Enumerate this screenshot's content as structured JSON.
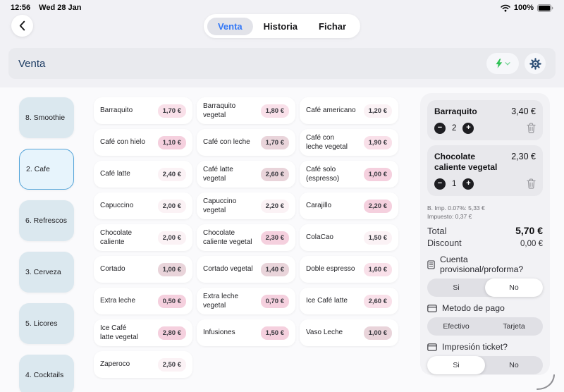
{
  "status_bar": {
    "time": "12:56",
    "date": "Wed 28 Jan",
    "battery_percent": "100%"
  },
  "nav_tabs": {
    "tabs": [
      {
        "label": "Venta",
        "active": true
      },
      {
        "label": "Historia",
        "active": false
      },
      {
        "label": "Fichar",
        "active": false
      }
    ]
  },
  "header": {
    "title": "Venta"
  },
  "sidebar": {
    "items": [
      {
        "label": "8. Smoothie",
        "active": false
      },
      {
        "label": "2. Cafe",
        "active": true
      },
      {
        "label": "6. Refrescos",
        "active": false
      },
      {
        "label": "3. Cerveza",
        "active": false
      },
      {
        "label": "5. Licores",
        "active": false
      },
      {
        "label": "4. Cocktails",
        "active": false
      }
    ]
  },
  "products": {
    "columns": [
      {
        "items": [
          {
            "name": "Barraquito",
            "price": "1,70 €",
            "tone": "t2"
          },
          {
            "name": "Café con hielo",
            "price": "1,10 €",
            "tone": "t3"
          },
          {
            "name": "Café latte",
            "price": "2,40 €",
            "tone": "t1"
          },
          {
            "name": "Capuccino",
            "price": "2,00 €",
            "tone": "t1"
          },
          {
            "name": "Chocolate\ncaliente",
            "price": "2,00 €",
            "tone": "t1"
          },
          {
            "name": "Cortado",
            "price": "1,00 €",
            "tone": "t4"
          },
          {
            "name": "Extra leche",
            "price": "0,50 €",
            "tone": "t3"
          },
          {
            "name": "Ice Café\nlatte vegetal",
            "price": "2,80 €",
            "tone": "t3"
          },
          {
            "name": "Zaperoco",
            "price": "2,50 €",
            "tone": "t1"
          }
        ]
      },
      {
        "items": [
          {
            "name": "Barraquito vegetal",
            "price": "1,80 €",
            "tone": "t2"
          },
          {
            "name": "Café con leche",
            "price": "1,70 €",
            "tone": "t4"
          },
          {
            "name": "Café latte vegetal",
            "price": "2,60 €",
            "tone": "t4"
          },
          {
            "name": "Capuccino\nvegetal",
            "price": "2,20 €",
            "tone": "t1"
          },
          {
            "name": "Chocolate\ncaliente vegetal",
            "price": "2,30 €",
            "tone": "t3"
          },
          {
            "name": "Cortado vegetal",
            "price": "1,40 €",
            "tone": "t4"
          },
          {
            "name": "Extra leche\nvegetal",
            "price": "0,70 €",
            "tone": "t3"
          },
          {
            "name": "Infusiones",
            "price": "1,50 €",
            "tone": "t3"
          }
        ]
      },
      {
        "items": [
          {
            "name": "Café americano",
            "price": "1,20 €",
            "tone": "t1"
          },
          {
            "name": "Café con\nleche vegetal",
            "price": "1,90 €",
            "tone": "t2"
          },
          {
            "name": "Café solo\n(espresso)",
            "price": "1,00 €",
            "tone": "t3"
          },
          {
            "name": "Carajillo",
            "price": "2,20 €",
            "tone": "t3"
          },
          {
            "name": "ColaCao",
            "price": "1,50 €",
            "tone": "t1"
          },
          {
            "name": "Doble espresso",
            "price": "1,60 €",
            "tone": "t2"
          },
          {
            "name": "Ice Café latte",
            "price": "2,60 €",
            "tone": "t2"
          },
          {
            "name": "Vaso Leche",
            "price": "1,00 €",
            "tone": "t4"
          }
        ]
      }
    ]
  },
  "cart": {
    "items": [
      {
        "name": "Barraquito",
        "price": "3,40 €",
        "qty": "2"
      },
      {
        "name": "Chocolate\ncaliente vegetal",
        "price": "2,30 €",
        "qty": "1"
      }
    ],
    "tax_base_line": "B. Imp. 0.07%:  5,33 €",
    "tax_line": "Impuesto:  0,37 €",
    "total_label": "Total",
    "total_value": "5,70 €",
    "discount_label": "Discount",
    "discount_value": "0,00 €",
    "toggles": [
      {
        "icon": "receipt-icon",
        "label": "Cuenta provisional/proforma?",
        "options": [
          "Si",
          "No"
        ],
        "selected_index": 1
      },
      {
        "icon": "card-icon",
        "label": "Metodo de pago",
        "options": [
          "Efectivo",
          "Tarjeta"
        ],
        "selected_index": -1
      },
      {
        "icon": "card-icon",
        "label": "Impresión ticket?",
        "options": [
          "Si",
          "No"
        ],
        "selected_index": 0
      }
    ]
  },
  "icons": {
    "minus": "−",
    "plus": "+"
  },
  "colors": {
    "accent_blue": "#3478f6",
    "header_text": "#1d3c63",
    "bolt_green": "#2fc155",
    "sidebar_active_border": "#55a5d9",
    "badge_tones": {
      "t1": "#fbf2f5",
      "t2": "#f9e0e9",
      "t3": "#f5d0de",
      "t4": "#e9d4da"
    }
  }
}
